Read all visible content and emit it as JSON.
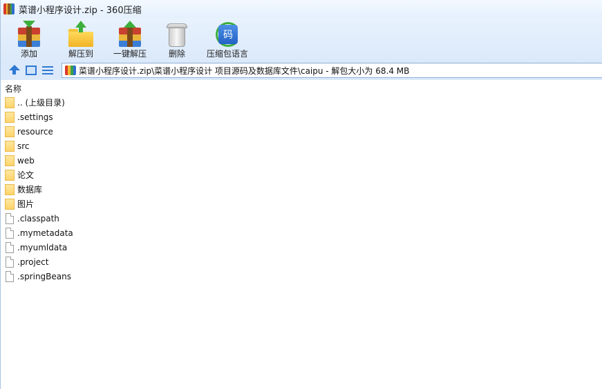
{
  "window": {
    "title": "菜谱小程序设计.zip - 360压缩"
  },
  "toolbar": {
    "items": [
      {
        "label": "添加",
        "icon": "add-archive-icon"
      },
      {
        "label": "解压到",
        "icon": "extract-to-icon"
      },
      {
        "label": "一键解压",
        "icon": "one-click-extract-icon"
      },
      {
        "label": "删除",
        "icon": "trash-icon"
      },
      {
        "label": "压缩包语言",
        "icon": "archive-language-icon"
      }
    ],
    "code_glyph": "码"
  },
  "address": {
    "path": "菜谱小程序设计.zip\\菜谱小程序设计 项目源码及数据库文件\\caipu - 解包大小为 68.4 MB"
  },
  "list": {
    "column_name": "名称",
    "rows": [
      {
        "type": "folder",
        "name": ".. (上级目录)"
      },
      {
        "type": "folder",
        "name": ".settings"
      },
      {
        "type": "folder",
        "name": "resource"
      },
      {
        "type": "folder",
        "name": "src"
      },
      {
        "type": "folder",
        "name": "web"
      },
      {
        "type": "folder",
        "name": "论文"
      },
      {
        "type": "folder",
        "name": "数据库"
      },
      {
        "type": "folder",
        "name": "图片"
      },
      {
        "type": "file",
        "name": ".classpath"
      },
      {
        "type": "file",
        "name": ".mymetadata"
      },
      {
        "type": "file",
        "name": ".myumldata"
      },
      {
        "type": "file",
        "name": ".project"
      },
      {
        "type": "file",
        "name": ".springBeans"
      }
    ]
  }
}
